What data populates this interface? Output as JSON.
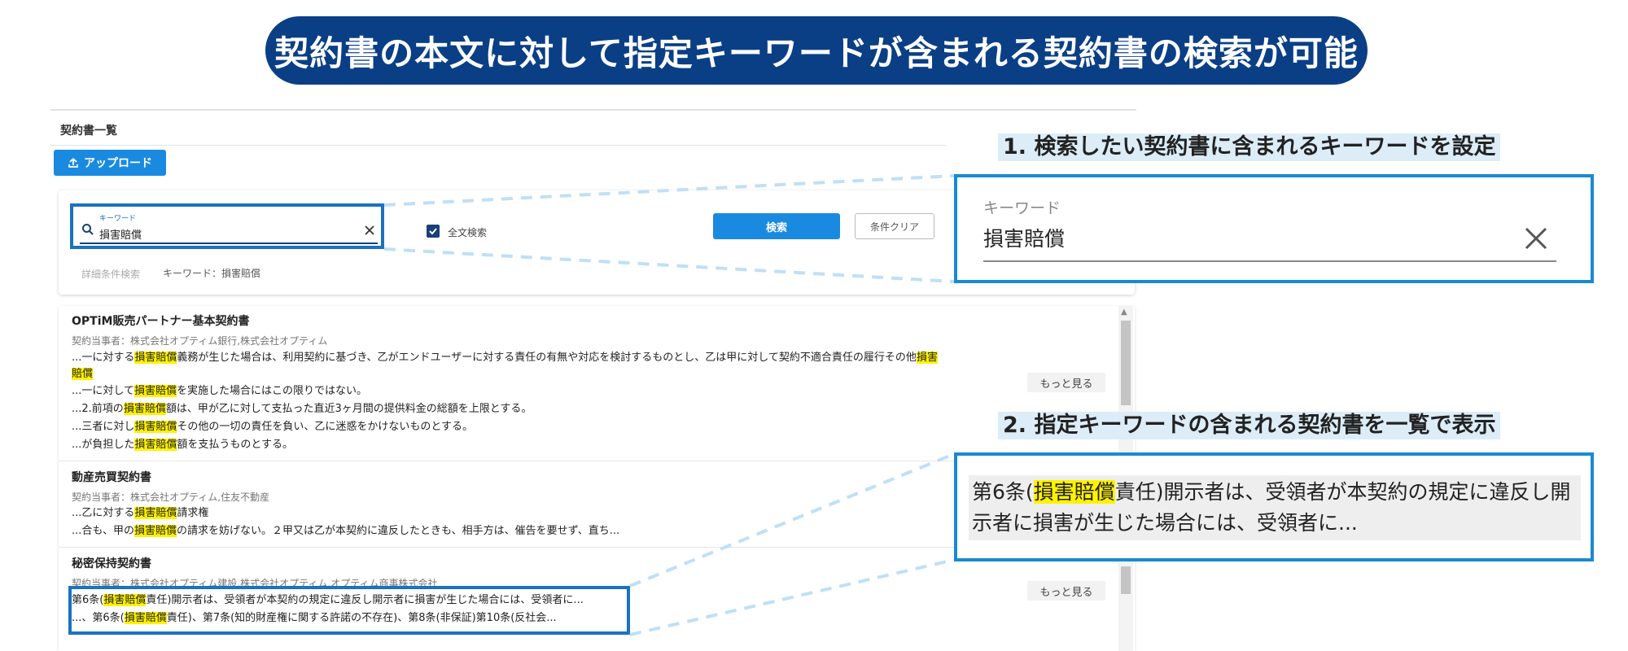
{
  "banner": {
    "text": "契約書の本文に対して指定キーワードが含まれる契約書の検索が可能"
  },
  "app": {
    "list_title": "契約書一覧",
    "upload_label": "アップロード",
    "search": {
      "keyword_label": "キーワード",
      "keyword_value": "損害賠償",
      "fulltext_label": "全文検索",
      "search_button": "検索",
      "clear_button": "条件クリア",
      "advanced_label": "詳細条件検索",
      "condition_text": "キーワード：損害賠償"
    },
    "more_label": "もっと見る",
    "results": [
      {
        "title": "OPTiM販売パートナー基本契約書",
        "parties": "契約当事者：株式会社オプティム銀行,株式会社オプティム",
        "l1_pre": "...一に対する",
        "l1_hl": "損害賠償",
        "l1_mid": "義務が生じた場合は、利用契約に基づき、乙がエンドユーザーに対する責任の有無や対応を検討するものとし、乙は甲に対して契約不適合責任の履行その他",
        "l1_hl2a": "損害",
        "l1_hl2b": "賠償",
        "l2_pre": "...一に対して",
        "l2_hl": "損害賠償",
        "l2_post": "を実施した場合にはこの限りではない。",
        "l3_pre": "...2.前項の",
        "l3_hl": "損害賠償",
        "l3_post": "額は、甲が乙に対して支払った直近3ヶ月間の提供料金の総額を上限とする。",
        "l4_pre": "...三者に対し",
        "l4_hl": "損害賠償",
        "l4_post": "その他の一切の責任を負い、乙に迷惑をかけないものとする。",
        "l5_pre": "...が負担した",
        "l5_hl": "損害賠償",
        "l5_post": "額を支払うものとする。"
      },
      {
        "title": "動産売買契約書",
        "parties": "契約当事者：株式会社オプティム,住友不動産",
        "l1_pre": "...乙に対する",
        "l1_hl": "損害賠償",
        "l1_post": "請求権",
        "l2_pre": "...合も、甲の",
        "l2_hl": "損害賠償",
        "l2_post": "の請求を妨げない。２甲又は乙が本契約に違反したときも、相手方は、催告を要せず、直ち..."
      },
      {
        "title": "秘密保持契約書",
        "parties": "契約当事者：株式会社オプティム建設,株式会社オプティム,オプティム商事株式会社",
        "l1_pre": "第6条(",
        "l1_hl": "損害賠償",
        "l1_post": "責任)開示者は、受領者が本契約の規定に違反し開示者に損害が生じた場合には、受領者に...",
        "l2_pre": "...、第6条(",
        "l2_hl": "損害賠償",
        "l2_post": "責任)、第7条(知的財産権に関する許諾の不存在)、第8条(非保証)第10条(反社会..."
      }
    ]
  },
  "steps": {
    "step1": "1. 検索したい契約書に含まれるキーワードを設定",
    "step2": "2. 指定キーワードの含まれる契約書を一覧で表示"
  },
  "zoom1": {
    "label": "キーワード",
    "value": "損害賠償"
  },
  "zoom2": {
    "pre": "第6条(",
    "hl": "損害賠償",
    "post": "責任)開示者は、受領者が本契約の規定に違反し開示者に損害が生じた場合には、受領者に..."
  },
  "colors": {
    "banner": "#0a3f86",
    "accent": "#1a8ae0",
    "highlight": "#fff200",
    "callout_border": "#1a8ad0"
  },
  "icons": {
    "upload": "upload-icon",
    "search": "search-icon",
    "clear": "close-icon",
    "check": "check-icon"
  }
}
